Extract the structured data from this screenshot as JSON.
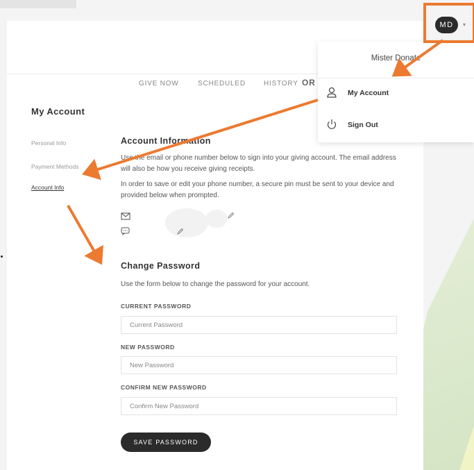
{
  "header": {
    "nav": [
      "GIVE NOW",
      "SCHEDULED",
      "HISTORY",
      "OR"
    ],
    "avatar": {
      "initials": "MD",
      "caret": "▾"
    }
  },
  "user_menu": {
    "name": "Mister Donate",
    "items": [
      {
        "label": "My Account",
        "icon": "user-icon"
      },
      {
        "label": "Sign Out",
        "icon": "power-icon"
      }
    ]
  },
  "sidebar": {
    "title": "My Account",
    "items": [
      {
        "label": "Personal Info",
        "active": false
      },
      {
        "label": "Payment Methods",
        "active": false
      },
      {
        "label": "Account Info",
        "active": true
      }
    ]
  },
  "account_info": {
    "heading": "Account Information",
    "text1": "Use the email or phone number below to sign into your giving account. The email address will also be how you receive giving receipts.",
    "text2": "In order to save or edit your phone number, a secure pin must be sent to your device and provided below when prompted.",
    "icons": [
      "mail-icon",
      "pencil-icon",
      "chat-icon",
      "pencil-icon"
    ]
  },
  "change_password": {
    "heading": "Change Password",
    "description": "Use the form below to change the password for your account.",
    "fields": [
      {
        "label": "CURRENT PASSWORD",
        "placeholder": "Current Password",
        "value": ""
      },
      {
        "label": "NEW PASSWORD",
        "placeholder": "New Password",
        "value": ""
      },
      {
        "label": "CONFIRM NEW PASSWORD",
        "placeholder": "Confirm New Password",
        "value": ""
      }
    ],
    "submit_label": "SAVE PASSWORD"
  },
  "colors": {
    "annotation": "#ec7a30",
    "button": "#2b2b2b",
    "background": "#f4f4f4"
  }
}
